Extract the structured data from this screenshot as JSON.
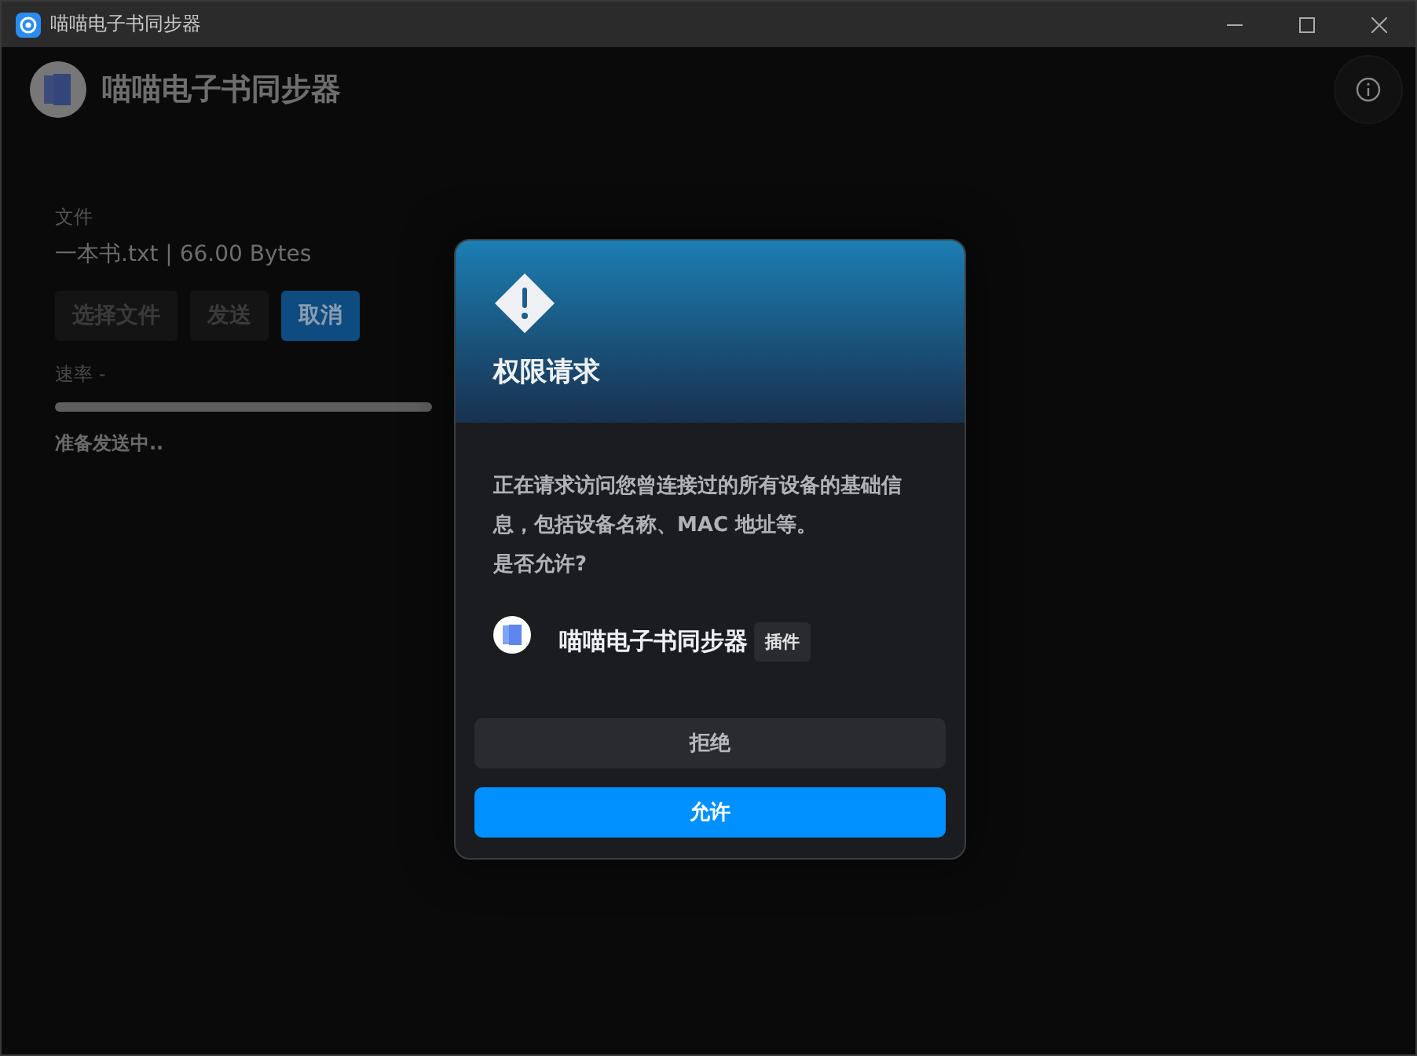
{
  "window": {
    "title": "喵喵电子书同步器"
  },
  "header": {
    "title": "喵喵电子书同步器"
  },
  "transfer": {
    "file_label": "文件",
    "file_info": "一本书.txt | 66.00 Bytes",
    "buttons": [
      {
        "label": "选择文件",
        "disabled": true
      },
      {
        "label": "发送",
        "disabled": true
      },
      {
        "label": "取消",
        "disabled": false
      }
    ],
    "rate": "速率 -",
    "progress": {
      "level": 0
    },
    "status": "准备发送中.."
  },
  "dialog": {
    "title": "权限请求",
    "message": "正在请求访问您曾连接过的所有设备的基础信息，包括设备名称、MAC 地址等。",
    "question": "是否允许?",
    "plugin": {
      "name": "喵喵电子书同步器",
      "badge": "插件"
    },
    "buttons": [
      {
        "label": "拒绝",
        "kind": "secondary"
      },
      {
        "label": "允许",
        "kind": "primary"
      }
    ]
  }
}
